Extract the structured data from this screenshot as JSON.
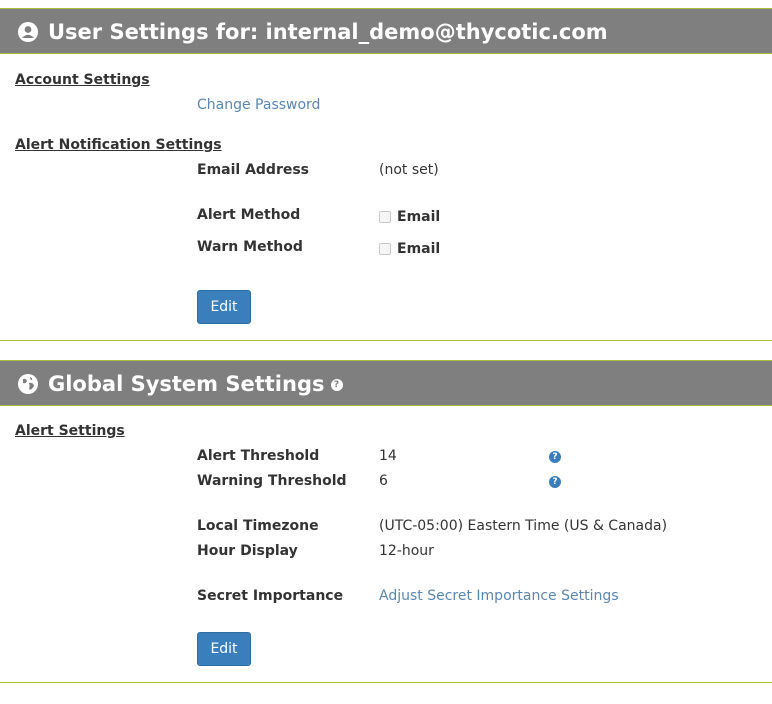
{
  "user_settings": {
    "title": "User Settings for: internal_demo@thycotic.com",
    "account_section": "Account Settings",
    "change_password_link": "Change Password",
    "alert_section": "Alert Notification Settings",
    "email_address_label": "Email Address",
    "email_address_value": "(not set)",
    "alert_method_label": "Alert Method",
    "alert_method_option": "Email",
    "alert_method_checked": false,
    "warn_method_label": "Warn Method",
    "warn_method_option": "Email",
    "warn_method_checked": false,
    "edit_label": "Edit"
  },
  "global_settings": {
    "title": "Global System Settings",
    "help_glyph": "?",
    "alert_section": "Alert Settings",
    "alert_threshold_label": "Alert Threshold",
    "alert_threshold_value": "14",
    "warning_threshold_label": "Warning Threshold",
    "warning_threshold_value": "6",
    "timezone_label": "Local Timezone",
    "timezone_value": "(UTC-05:00) Eastern Time (US & Canada)",
    "hour_display_label": "Hour Display",
    "hour_display_value": "12-hour",
    "secret_importance_label": "Secret Importance",
    "secret_importance_link": "Adjust Secret Importance Settings",
    "edit_label": "Edit"
  },
  "colors": {
    "header_bg": "#7f7f7f",
    "accent_line": "#a7c13a",
    "button_bg": "#3a7fbc",
    "link": "#5b86b0"
  }
}
